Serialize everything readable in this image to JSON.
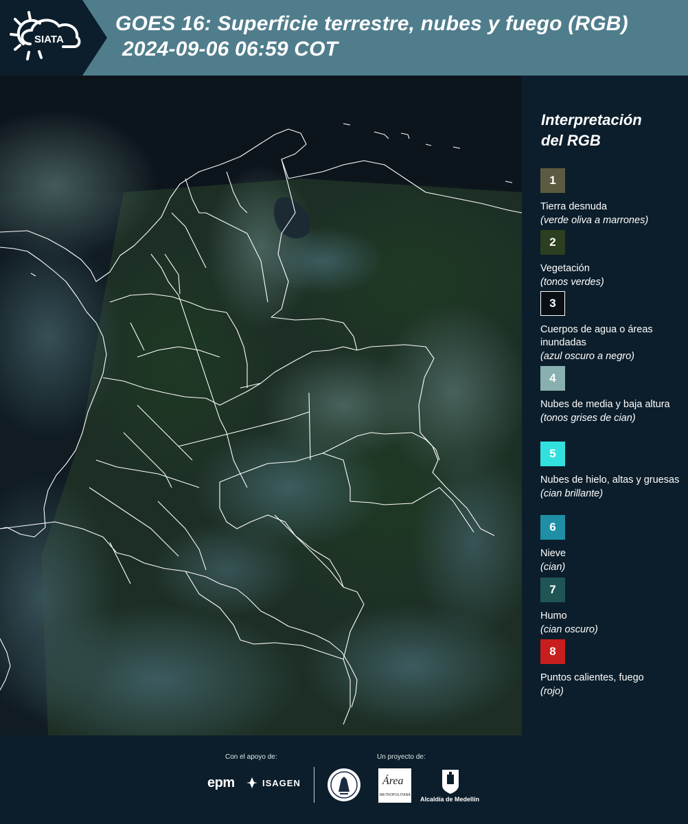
{
  "header": {
    "logo_text": "SIATA",
    "title_line1": "GOES 16: Superficie terrestre, nubes y fuego (RGB)",
    "title_line2": "2024-09-06 06:59 COT"
  },
  "legend": {
    "title_line1": "Interpretación",
    "title_line2": "del RGB",
    "items": [
      {
        "number": "1",
        "color": "#5c5a40",
        "name": "Tierra desnuda",
        "desc": "(verde oliva a marrones)"
      },
      {
        "number": "2",
        "color": "#2c3f20",
        "name": "Vegetación",
        "desc": "(tonos verdes)"
      },
      {
        "number": "3",
        "color": "#0a0f16",
        "name": "Cuerpos de agua o áreas inundadas",
        "desc": "(azul oscuro a negro)"
      },
      {
        "number": "4",
        "color": "#89b0b0",
        "name": "Nubes de media y baja altura",
        "desc": "(tonos grises de cian)"
      },
      {
        "number": "5",
        "color": "#33e0e0",
        "name": "Nubes de hielo, altas y gruesas",
        "desc": "(cian brillante)"
      },
      {
        "number": "6",
        "color": "#1e8fa5",
        "name": "Nieve",
        "desc": "(cian)"
      },
      {
        "number": "7",
        "color": "#1f5554",
        "name": "Humo",
        "desc": "(cian oscuro)"
      },
      {
        "number": "8",
        "color": "#c81e1e",
        "name": "Puntos calientes, fuego",
        "desc": "(rojo)"
      }
    ]
  },
  "footer": {
    "support_label": "Con el apoyo de:",
    "project_label": "Un proyecto de:",
    "epm": "epm",
    "isagen": "ISAGEN",
    "area_word": "Área",
    "area_sub": "METROPOLITANA",
    "alcaldia": "Alcaldía de Medellín"
  },
  "colors": {
    "header_band": "#507d8c",
    "background": "#0c1e2b",
    "borders": "#ffffff"
  }
}
